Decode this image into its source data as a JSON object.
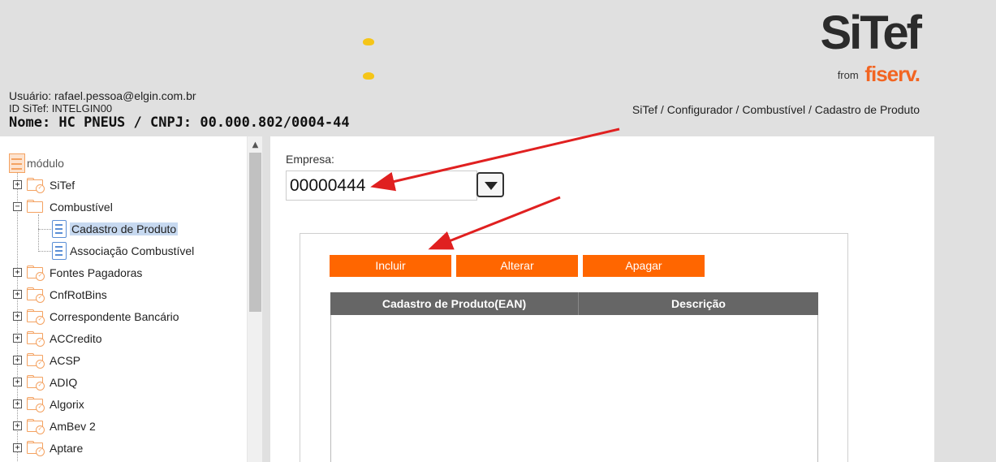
{
  "header": {
    "logo": {
      "main": "SiTef",
      "from": "from",
      "brand": "fiserv."
    },
    "user_line": "Usuário: rafael.pessoa@elgin.com.br",
    "id_line": "ID SiTef: INTELGIN00",
    "company_line": "Nome: HC PNEUS / CNPJ: 00.000.802/0004-44",
    "breadcrumb": "SiTef / Configurador / Combustível / Cadastro de Produto"
  },
  "sidebar": {
    "root_label": "módulo",
    "items": [
      {
        "label": "SiTef",
        "expander": "+"
      },
      {
        "label": "Combustível",
        "expander": "−"
      },
      {
        "label": "Cadastro de Produto",
        "selected": true
      },
      {
        "label": "Associação Combustível"
      },
      {
        "label": "Fontes Pagadoras",
        "expander": "+"
      },
      {
        "label": "CnfRotBins",
        "expander": "+"
      },
      {
        "label": "Correspondente Bancário",
        "expander": "+"
      },
      {
        "label": "ACCredito",
        "expander": "+"
      },
      {
        "label": "ACSP",
        "expander": "+"
      },
      {
        "label": "ADIQ",
        "expander": "+"
      },
      {
        "label": "Algorix",
        "expander": "+"
      },
      {
        "label": "AmBev 2",
        "expander": "+"
      },
      {
        "label": "Aptare",
        "expander": "+"
      }
    ]
  },
  "main": {
    "empresa_label": "Empresa:",
    "empresa_value": "00000444",
    "buttons": {
      "incluir": "Incluir",
      "alterar": "Alterar",
      "apagar": "Apagar"
    },
    "grid": {
      "columns": [
        "Cadastro de Produto(EAN)",
        "Descrição"
      ]
    }
  },
  "colors": {
    "accent": "#ff6600",
    "grid_header": "#666666",
    "folder": "#f4a261",
    "annotation_arrow": "#e02020"
  }
}
